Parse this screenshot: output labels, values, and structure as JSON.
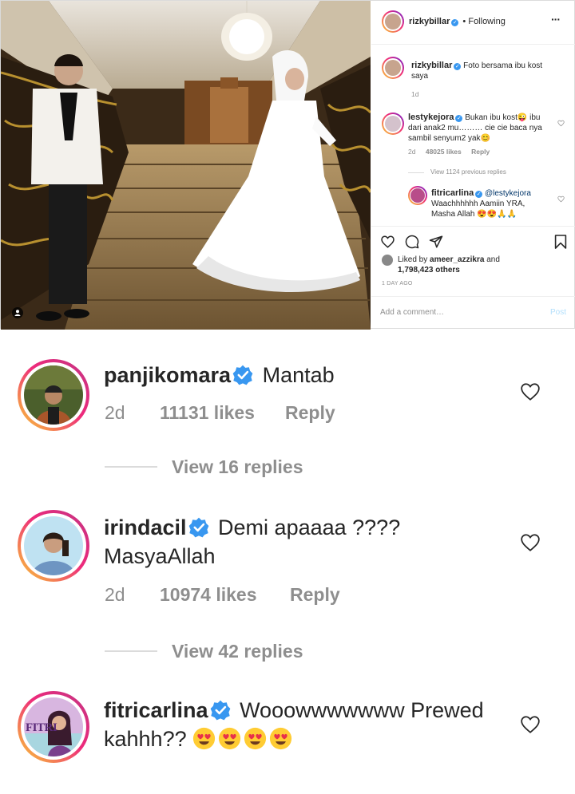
{
  "post": {
    "header": {
      "username": "rizkybillar",
      "separator": "•",
      "following_label": "Following",
      "more_label": "···"
    },
    "caption": {
      "username": "rizkybillar",
      "text": "Foto bersama ibu kost saya",
      "time": "1d"
    },
    "comment1": {
      "username": "lestykejora",
      "text": "Bukan ibu kost😜 ibu dari anak2 mu……… cie cie baca nya sambil senyum2 yak😊",
      "time": "2d",
      "likes": "48025 likes",
      "reply_label": "Reply"
    },
    "view_previous": "View 1124 previous replies",
    "reply1": {
      "username": "fitricarlina",
      "mention": "@lestykejora",
      "text": "Waachhhhhh Aamiin YRA, Masha Allah 😍😍🙏🙏"
    },
    "liked_by_prefix": "Liked by",
    "liked_by_user": "ameer_azzikra",
    "liked_by_suffix": "and",
    "likes_count": "1,798,423 others",
    "posted_ago": "1 DAY AGO",
    "add_comment_placeholder": "Add a comment…",
    "post_button": "Post"
  },
  "comments": [
    {
      "username": "panjikomara",
      "text": "Mantab",
      "time": "2d",
      "likes": "11131 likes",
      "reply_label": "Reply",
      "view_replies": "View 16 replies"
    },
    {
      "username": "irindacil",
      "text_line1": "Demi apaaaa ????",
      "text_line2": "MasyaAllah",
      "time": "2d",
      "likes": "10974 likes",
      "reply_label": "Reply",
      "view_replies": "View 42 replies"
    },
    {
      "username": "fitricarlina",
      "text_line1": "Wooowwwwwww Prewed",
      "text_line2": "kahhh??",
      "avatar_text": "FITRI"
    }
  ],
  "colors": {
    "verified": "#3897f0",
    "story_ring_start": "#f9ce34",
    "story_ring_mid": "#ee2a7b",
    "story_ring_end": "#6228d7",
    "muted_text": "#8e8e8e"
  }
}
